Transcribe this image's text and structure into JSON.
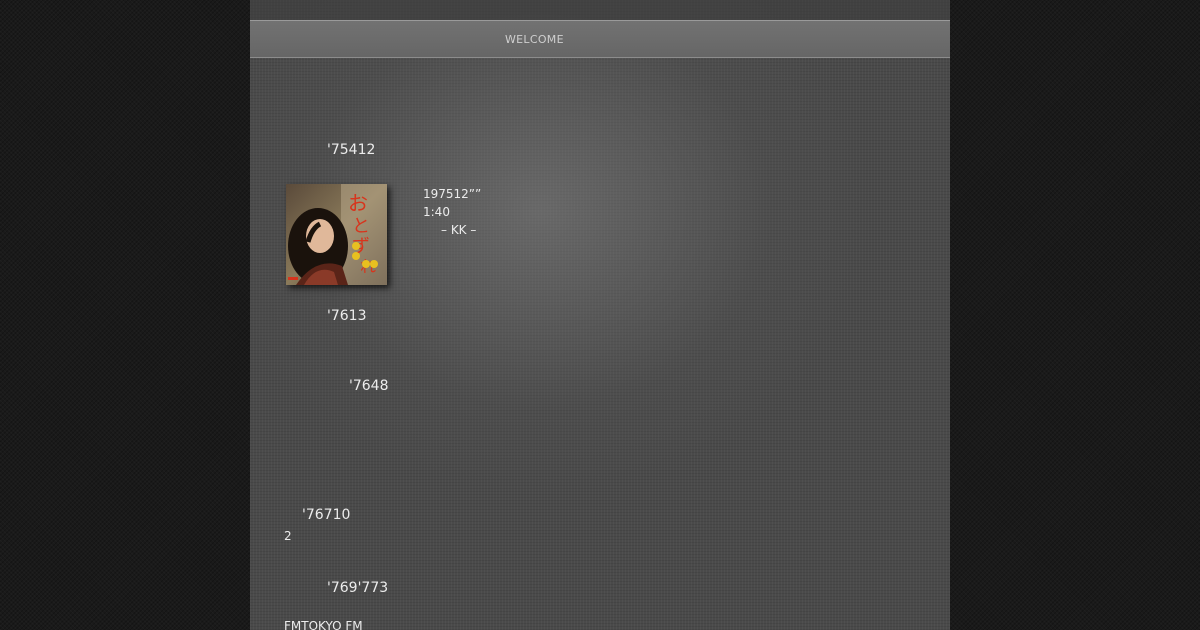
{
  "nav": {
    "items": [
      {
        "label": "WELCOME"
      }
    ]
  },
  "content": {
    "entries": [
      {
        "heading": "'75412"
      },
      {
        "heading": "'7613"
      },
      {
        "heading": "'7648"
      },
      {
        "heading": "'76710",
        "text": "2"
      },
      {
        "heading": "'769'773",
        "text": "FMTOKYO FM"
      }
    ],
    "release": {
      "line1": "197512””",
      "line2": "1:40",
      "line3": "– KK –"
    }
  }
}
